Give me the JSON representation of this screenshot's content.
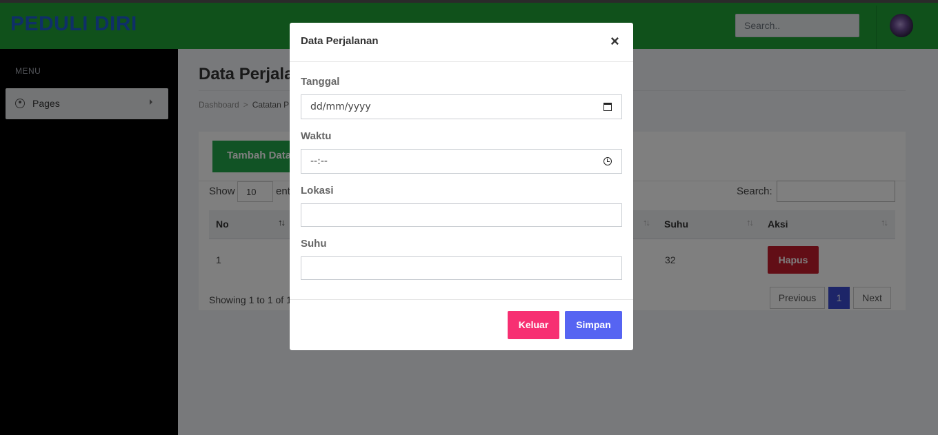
{
  "header": {
    "brand": "PEDULI DIRI",
    "search_placeholder": "Search.."
  },
  "sidebar": {
    "menu_title": "MENU",
    "items": [
      {
        "label": "Pages",
        "icon": "user-circle-icon"
      }
    ]
  },
  "main": {
    "title": "Data Perjala",
    "breadcrumb": {
      "home": "Dashboard",
      "separator": ">",
      "current": "Catatan P"
    },
    "add_button": "Tambah Data",
    "show_label": "Show",
    "show_value": "10",
    "show_after": "ent",
    "search_label": "Search:",
    "table": {
      "headers": {
        "no": "No",
        "suhu": "Suhu",
        "aksi": "Aksi"
      },
      "rows": [
        {
          "no": "1",
          "suhu": "32",
          "action": "Hapus"
        }
      ]
    },
    "info": "Showing 1 to 1 of 1",
    "pagination": {
      "previous": "Previous",
      "page": "1",
      "next": "Next"
    }
  },
  "modal": {
    "title": "Data Perjalanan",
    "close": "×",
    "fields": {
      "tanggal": {
        "label": "Tanggal",
        "placeholder": "dd/mm/yyyy"
      },
      "waktu": {
        "label": "Waktu",
        "placeholder": "--:--"
      },
      "lokasi": {
        "label": "Lokasi"
      },
      "suhu": {
        "label": "Suhu"
      }
    },
    "buttons": {
      "keluar": "Keluar",
      "simpan": "Simpan"
    }
  },
  "colors": {
    "header": "#21a337",
    "brand": "#1f5fd1",
    "keluar": "#f72f72",
    "simpan": "#5664f2",
    "hapus": "#c41c2c",
    "add": "#23a64a"
  }
}
